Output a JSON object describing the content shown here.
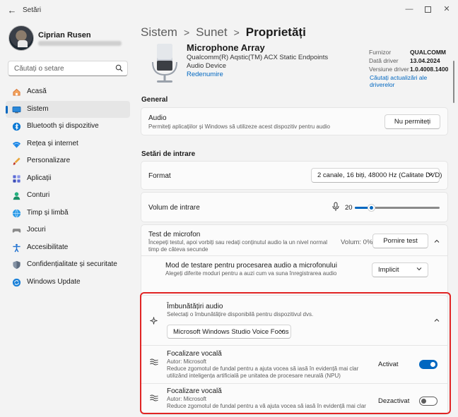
{
  "window": {
    "title": "Setări"
  },
  "profile": {
    "name": "Ciprian Rusen"
  },
  "search": {
    "placeholder": "Căutați o setare"
  },
  "sidebar": {
    "items": [
      {
        "label": "Acasă",
        "icon": "home-icon",
        "color": "#e07a3c"
      },
      {
        "label": "Sistem",
        "icon": "system-icon",
        "color": "#0067c0"
      },
      {
        "label": "Bluetooth și dispozitive",
        "icon": "bluetooth-icon",
        "color": "#0078d4"
      },
      {
        "label": "Rețea și internet",
        "icon": "wifi-icon",
        "color": "#0078d4"
      },
      {
        "label": "Personalizare",
        "icon": "brush-icon",
        "color": "#e8a53b"
      },
      {
        "label": "Aplicații",
        "icon": "apps-icon",
        "color": "#4a5bcf"
      },
      {
        "label": "Conturi",
        "icon": "person-icon",
        "color": "#1aa37a"
      },
      {
        "label": "Timp și limbă",
        "icon": "globe-clock-icon",
        "color": "#1f8fd6"
      },
      {
        "label": "Jocuri",
        "icon": "gamepad-icon",
        "color": "#7b7b7b"
      },
      {
        "label": "Accesibilitate",
        "icon": "accessibility-icon",
        "color": "#1d6fd0"
      },
      {
        "label": "Confidențialitate și securitate",
        "icon": "shield-icon",
        "color": "#7a8595"
      },
      {
        "label": "Windows Update",
        "icon": "update-icon",
        "color": "#0078d4"
      }
    ]
  },
  "breadcrumb": {
    "part1": "Sistem",
    "part2": "Sunet",
    "current": "Proprietăți"
  },
  "device": {
    "name": "Microphone Array",
    "description": "Qualcomm(R) Aqstic(TM) ACX Static Endpoints Audio Device",
    "rename": "Redenumire",
    "info_labels": [
      "Furnizor",
      "Dată driver",
      "Versiune driver"
    ],
    "info_values": [
      "QUALCOMM",
      "13.04.2024",
      "1.0.4008.1400"
    ],
    "update_link": "Căutați actualizări ale driverelor"
  },
  "general": {
    "heading": "General",
    "audio_title": "Audio",
    "audio_sub": "Permiteți aplicațiilor și Windows să utilizeze acest dispozitiv pentru audio",
    "audio_button": "Nu permiteți"
  },
  "input": {
    "heading": "Setări de intrare",
    "format_label": "Format",
    "format_value": "2 canale, 16 biți, 48000 Hz (Calitate DVD)",
    "volume_label": "Volum de intrare",
    "volume_value": "20",
    "volume_level": 0.2,
    "mictest_title": "Test de microfon",
    "mictest_sub": "Începeți testul, apoi vorbiți sau redați conținutul audio la un nivel normal timp de câteva secunde",
    "mictest_volume": "Volum: 0%",
    "mictest_button": "Pornire test",
    "testmode_title": "Mod de testare pentru procesarea audio a microfonului",
    "testmode_sub": "Alegeți diferite moduri pentru a auzi cum va suna înregistrarea audio",
    "testmode_value": "Implicit"
  },
  "enhancements": {
    "title": "Îmbunătățiri audio",
    "sub": "Selectați o îmbunătățire disponibilă pentru dispozitivul dvs.",
    "select_value": "Microsoft Windows Studio Voice Focus",
    "items": [
      {
        "title": "Focalizare vocală",
        "author": "Autor: Microsoft",
        "desc": "Reduce zgomotul de fundal pentru a ajuta vocea să iasă în evidență mai clar utilizând inteligența artificială pe unitatea de procesare neurală (NPU)",
        "state_label": "Activat",
        "on": true
      },
      {
        "title": "Focalizare vocală",
        "author": "Autor: Microsoft",
        "desc": "Reduce zgomotul de fundal pentru a vă ajuta vocea să iasă în evidență mai clar",
        "state_label": "Dezactivat",
        "on": false
      }
    ]
  },
  "colors": {
    "accent": "#0067c0",
    "highlight": "#e02424"
  }
}
